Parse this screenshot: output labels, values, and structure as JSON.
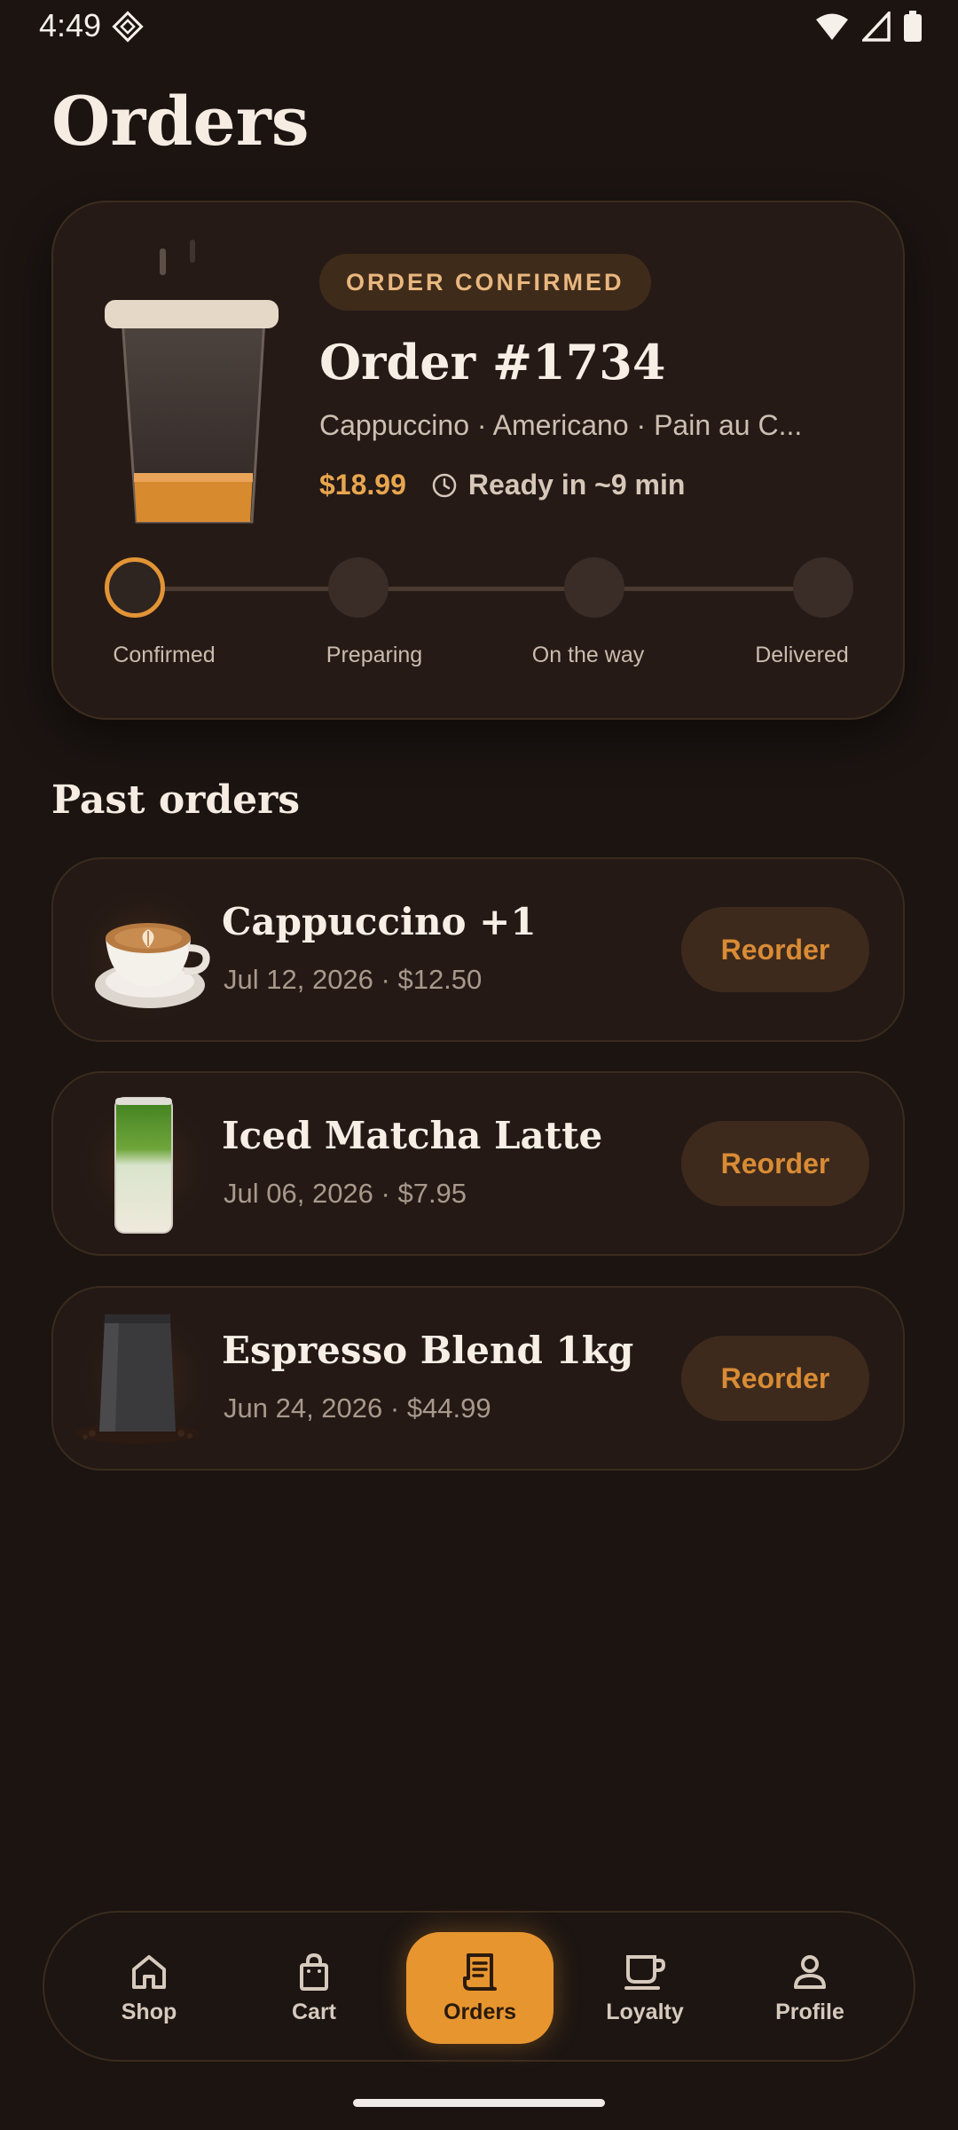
{
  "status_bar": {
    "time": "4:49"
  },
  "page_title": "Orders",
  "current_order": {
    "badge": "ORDER CONFIRMED",
    "number": "Order #1734",
    "items": "Cappuccino · Americano · Pain au C...",
    "total": "$18.99",
    "eta": "Ready in ~9 min",
    "steps": [
      "Confirmed",
      "Preparing",
      "On the way",
      "Delivered"
    ],
    "active_step": 0
  },
  "past_orders": {
    "title": "Past orders",
    "items": [
      {
        "name": "Cappuccino +1",
        "meta": "Jul 12, 2026 · $12.50",
        "button": "Reorder",
        "thumb": "cappuccino-cup-icon"
      },
      {
        "name": "Iced Matcha Latte",
        "meta": "Jul 06, 2026 · $7.95",
        "button": "Reorder",
        "thumb": "iced-matcha-glass-icon"
      },
      {
        "name": "Espresso Blend 1kg",
        "meta": "Jun 24, 2026 · $44.99",
        "button": "Reorder",
        "thumb": "coffee-bag-icon"
      }
    ]
  },
  "nav": {
    "items": [
      {
        "label": "Shop",
        "icon": "home-icon"
      },
      {
        "label": "Cart",
        "icon": "shopping-bag-icon"
      },
      {
        "label": "Orders",
        "icon": "receipt-icon"
      },
      {
        "label": "Loyalty",
        "icon": "coffee-cup-icon"
      },
      {
        "label": "Profile",
        "icon": "person-icon"
      }
    ],
    "active": "Orders"
  },
  "colors": {
    "accent": "#e7952f",
    "background": "#1b1411",
    "card": "#251a16",
    "badge_text": "#e9b77f"
  }
}
